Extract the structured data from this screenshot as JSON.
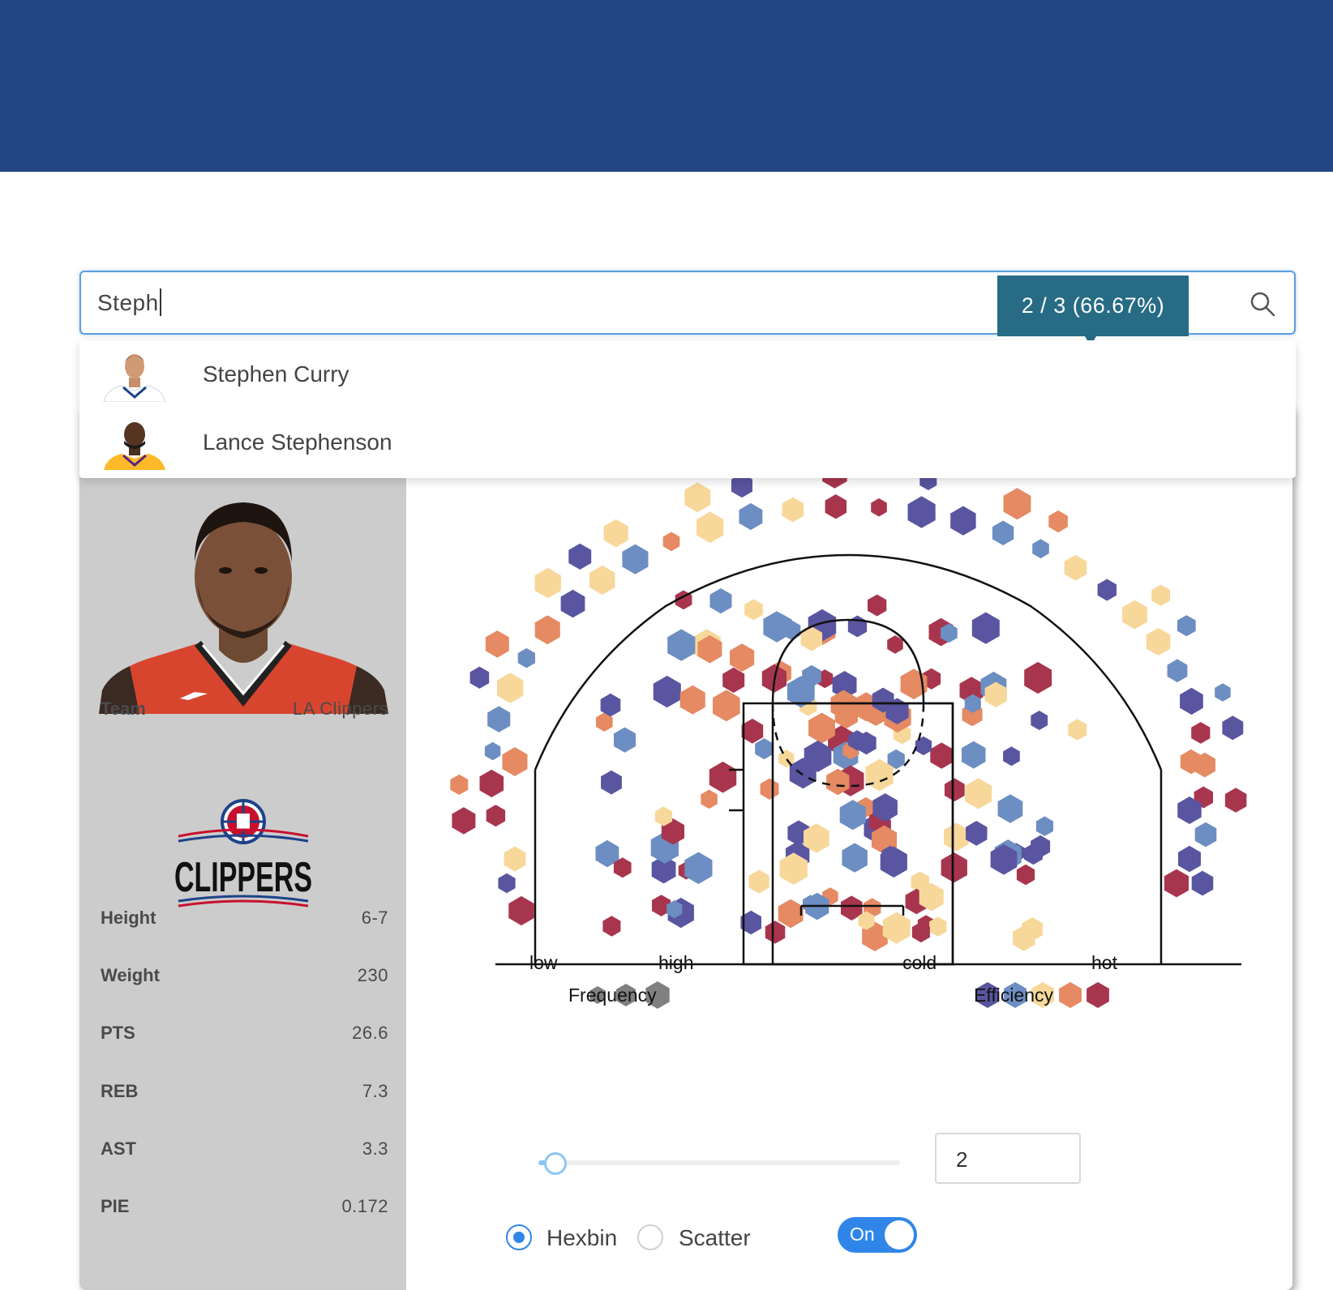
{
  "search": {
    "value": "Steph"
  },
  "suggestions": [
    {
      "name": "Stephen Curry",
      "jersey_color": "#1d428a"
    },
    {
      "name": "Lance Stephenson",
      "jersey_color": "#fdb927"
    }
  ],
  "player": {
    "team_label": "Team",
    "team": "LA Clippers",
    "team_logo_text": "CLIPPERS",
    "stats": [
      {
        "label": "Height",
        "value": "6-7"
      },
      {
        "label": "Weight",
        "value": "230"
      },
      {
        "label": "PTS",
        "value": "26.6"
      },
      {
        "label": "REB",
        "value": "7.3"
      },
      {
        "label": "AST",
        "value": "3.3"
      },
      {
        "label": "PIE",
        "value": "0.172"
      }
    ]
  },
  "tooltip": "2 / 3 (66.67%)",
  "legend": {
    "frequency": {
      "low": "low",
      "high": "high",
      "title": "Frequency"
    },
    "efficiency": {
      "cold": "cold",
      "hot": "hot",
      "title": "Efficiency"
    },
    "colors": [
      "#5a55a0",
      "#6c8ec2",
      "#f7d89a",
      "#e58a62",
      "#a8354e"
    ]
  },
  "controls": {
    "slider_value": "2",
    "radio_hexbin": "Hexbin",
    "radio_scatter": "Scatter",
    "toggle_label": "On"
  },
  "colors": {
    "header": "#244584",
    "accent": "#2f86e8",
    "tooltip": "#276b85",
    "sidebar": "#cccccc"
  }
}
